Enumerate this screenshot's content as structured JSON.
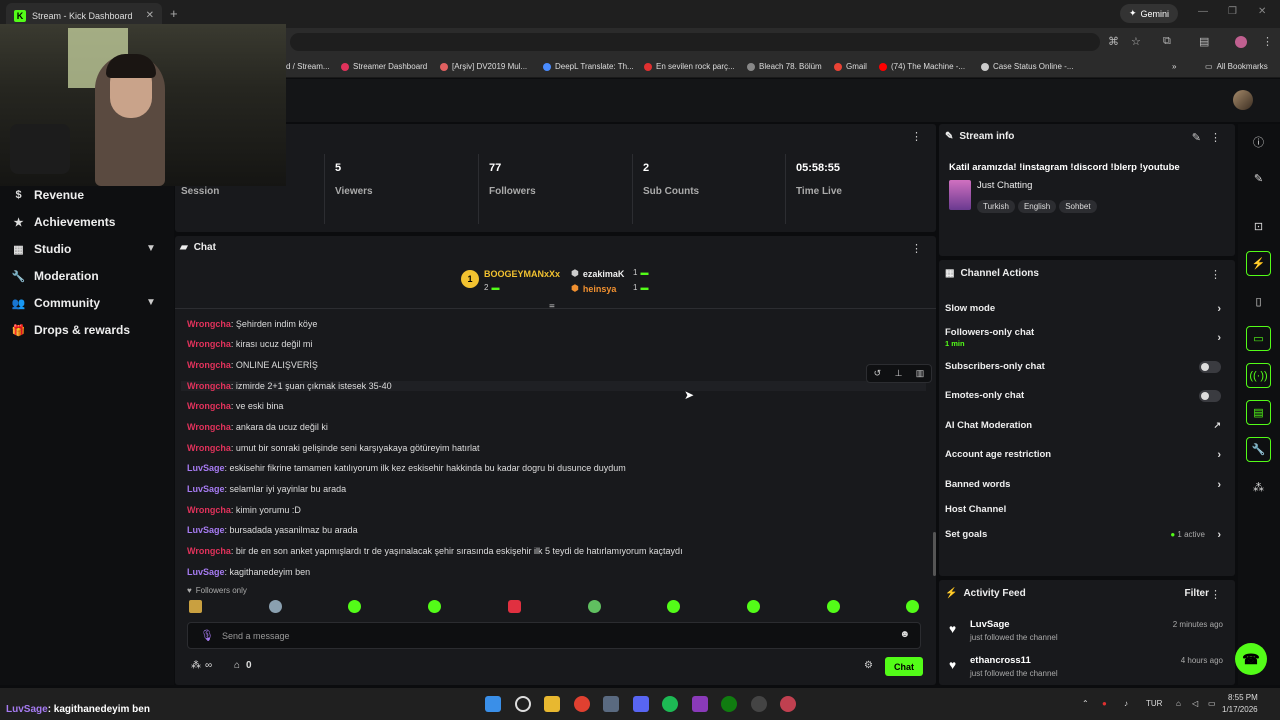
{
  "browser": {
    "tab_title": "Stream - Kick Dashboard",
    "tab_close": "✕",
    "new_tab": "+",
    "gemini_label": "Gemini",
    "bookmarks": [
      {
        "label": "d / Stream...",
        "color": "#53fc18"
      },
      {
        "label": "Streamer Dashboard",
        "color": "#e0325b"
      },
      {
        "label": "[Arşiv] DV2019 Mul...",
        "color": "#e06060"
      },
      {
        "label": "DeepL Translate: Th...",
        "color": "#4a8cff"
      },
      {
        "label": "En sevilen rock parç...",
        "color": "#e03030"
      },
      {
        "label": "Bleach 78. Bölüm",
        "color": "#888888"
      },
      {
        "label": "Gmail",
        "color": "#ea4335"
      },
      {
        "label": "(74) The Machine -...",
        "color": "#ff0000"
      },
      {
        "label": "Case Status Online -...",
        "color": "#cccccc"
      }
    ],
    "more_bookmarks": "»",
    "all_bookmarks": "All Bookmarks"
  },
  "sidebar": {
    "items": [
      {
        "label": "Revenue",
        "icon": "$",
        "has_chevron": false
      },
      {
        "label": "Achievements",
        "icon": "★",
        "has_chevron": false
      },
      {
        "label": "Studio",
        "icon": "▦",
        "has_chevron": true
      },
      {
        "label": "Moderation",
        "icon": "🔧",
        "has_chevron": false
      },
      {
        "label": "Community",
        "icon": "👥",
        "has_chevron": true
      },
      {
        "label": "Drops & rewards",
        "icon": "🎁",
        "has_chevron": false
      }
    ]
  },
  "stats": {
    "session_label": "Session",
    "cells": [
      {
        "value": "5",
        "label": "Viewers"
      },
      {
        "value": "77",
        "label": "Followers"
      },
      {
        "value": "2",
        "label": "Sub Counts"
      },
      {
        "value": "05:58:55",
        "label": "Time Live"
      }
    ]
  },
  "chat": {
    "title": "Chat",
    "leaderboard": {
      "rank": "1",
      "top_user": "BOOGEYMANxXx",
      "top_count": "2",
      "others": [
        {
          "name": "ezakimaK",
          "count": "1"
        },
        {
          "name": "heinsya",
          "count": "1"
        }
      ]
    },
    "messages": [
      {
        "user": "Wrongcha",
        "type": "w",
        "text": "Şehirden indim köye"
      },
      {
        "user": "Wrongcha",
        "type": "w",
        "text": "kirası ucuz değil mi"
      },
      {
        "user": "Wrongcha",
        "type": "w",
        "text": "ONLINE ALIŞVERİŞ"
      },
      {
        "user": "Wrongcha",
        "type": "w",
        "text": "izmirde 2+1 şuan çıkmak istesek 35-40"
      },
      {
        "user": "Wrongcha",
        "type": "w",
        "text": "ve eski bina"
      },
      {
        "user": "Wrongcha",
        "type": "w",
        "text": "ankara da ucuz değil ki"
      },
      {
        "user": "Wrongcha",
        "type": "w",
        "text": "umut bir sonraki gelişinde seni karşıyakaya götüreyim hatırlat"
      },
      {
        "user": "LuvSage",
        "type": "l",
        "text": "eskisehir fikrine tamamen katılıyorum ilk kez eskisehir hakkinda bu kadar dogru bi dusunce duydum"
      },
      {
        "user": "LuvSage",
        "type": "l",
        "text": "selamlar iyi yayinlar bu arada"
      },
      {
        "user": "Wrongcha",
        "type": "w",
        "text": "kimin yorumu :D"
      },
      {
        "user": "LuvSage",
        "type": "l",
        "text": "bursadada yasanilmaz bu arada"
      },
      {
        "user": "Wrongcha",
        "type": "w",
        "text": "bir de en son anket yapmışlardı tr de yaşınalacak şehir sırasında eskişehir ilk 5 teydi de hatırlamıyorum kaçtaydı"
      },
      {
        "user": "LuvSage",
        "type": "l",
        "text": "kagithanedeyim ben"
      }
    ],
    "followers_only": "Followers only",
    "input_placeholder": "Send a message",
    "points_value": "∞",
    "gift_count": "0",
    "send_label": "Chat"
  },
  "stream_info": {
    "title": "Stream info",
    "stream_title": "Katil aramızda! !instagram !discord !blerp !youtube",
    "category": "Just Chatting",
    "tags": [
      "Turkish",
      "English",
      "Sohbet"
    ]
  },
  "channel_actions": {
    "title": "Channel Actions",
    "rows": [
      {
        "label": "Slow mode",
        "control": "arrow"
      },
      {
        "label": "Followers-only chat",
        "sub": "1 min",
        "control": "arrow"
      },
      {
        "label": "Subscribers-only chat",
        "control": "toggle"
      },
      {
        "label": "Emotes-only chat",
        "control": "toggle"
      },
      {
        "label": "AI Chat Moderation",
        "control": "external"
      },
      {
        "label": "Account age restriction",
        "control": "arrow"
      },
      {
        "label": "Banned words",
        "control": "arrow"
      },
      {
        "label": "Host Channel",
        "control": "none"
      },
      {
        "label": "Set goals",
        "control": "arrow",
        "status": "1 active"
      }
    ]
  },
  "activity": {
    "title": "Activity Feed",
    "filter": "Filter",
    "items": [
      {
        "user": "LuvSage",
        "action": "just followed the channel",
        "time": "2 minutes ago"
      },
      {
        "user": "ethancross11",
        "action": "just followed the channel",
        "time": "4 hours ago"
      }
    ]
  },
  "taskbar": {
    "overlay_user": "LuvSage",
    "overlay_text": ": kagithanedeyim ben",
    "lang": "TUR",
    "time": "8:55 PM",
    "date": "1/17/2026"
  },
  "colors": {
    "accent": "#53fc18",
    "wrongcha": "#e0325b",
    "luvsage": "#a67bf2"
  }
}
